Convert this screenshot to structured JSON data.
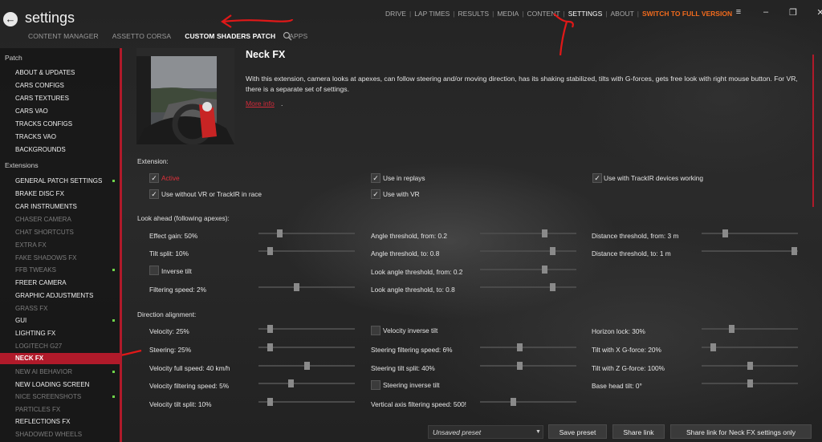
{
  "header": {
    "back_icon": "arrow-left-icon",
    "title": "settings",
    "subtabs": [
      {
        "label": "CONTENT MANAGER",
        "active": false
      },
      {
        "label": "ASSETTO CORSA",
        "active": false
      },
      {
        "label": "CUSTOM SHADERS PATCH",
        "active": true
      },
      {
        "label": "APPS",
        "active": false
      }
    ],
    "search_icon": "search-icon",
    "topnav": [
      "DRIVE",
      "LAP TIMES",
      "RESULTS",
      "MEDIA",
      "CONTENT",
      "SETTINGS",
      "ABOUT"
    ],
    "topnav_active": "SETTINGS",
    "full_version": "SWITCH TO FULL VERSION",
    "window_controls": [
      "menu-icon",
      "minimize-icon",
      "maximize-icon",
      "close-icon"
    ]
  },
  "sidebar": {
    "sections": [
      {
        "title": "Patch",
        "items": [
          {
            "label": "ABOUT & UPDATES"
          },
          {
            "label": "CARS CONFIGS"
          },
          {
            "label": "CARS TEXTURES"
          },
          {
            "label": "CARS VAO"
          },
          {
            "label": "TRACKS CONFIGS"
          },
          {
            "label": "TRACKS VAO"
          },
          {
            "label": "BACKGROUNDS"
          }
        ]
      },
      {
        "title": "Extensions",
        "items": [
          {
            "label": "GENERAL PATCH SETTINGS",
            "dot": true
          },
          {
            "label": "BRAKE DISC FX"
          },
          {
            "label": "CAR INSTRUMENTS"
          },
          {
            "label": "CHASER CAMERA",
            "dim": true
          },
          {
            "label": "CHAT SHORTCUTS",
            "dim": true
          },
          {
            "label": "EXTRA FX",
            "dim": true
          },
          {
            "label": "FAKE SHADOWS FX",
            "dim": true
          },
          {
            "label": "FFB TWEAKS",
            "dim": true,
            "dot": true
          },
          {
            "label": "FREER CAMERA"
          },
          {
            "label": "GRAPHIC ADJUSTMENTS"
          },
          {
            "label": "GRASS FX",
            "dim": true
          },
          {
            "label": "GUI",
            "dot": true
          },
          {
            "label": "LIGHTING FX"
          },
          {
            "label": "LOGITECH G27",
            "dim": true
          },
          {
            "label": "NECK FX",
            "selected": true
          },
          {
            "label": "NEW AI BEHAVIOR",
            "dim": true,
            "dot": true
          },
          {
            "label": "NEW LOADING SCREEN"
          },
          {
            "label": "NICE SCREENSHOTS",
            "dim": true,
            "dot": true
          },
          {
            "label": "PARTICLES FX",
            "dim": true
          },
          {
            "label": "REFLECTIONS FX"
          },
          {
            "label": "SHADOWED WHEELS",
            "dim": true
          }
        ]
      }
    ]
  },
  "main": {
    "title": "Neck FX",
    "description": "With this extension, camera looks at apexes, can follow steering and/or moving direction, has its shaking stabilized, tilts with G-forces, gets free look with right mouse button. For VR, there is a separate set of settings.",
    "more_info": "More info",
    "extension": {
      "title": "Extension:",
      "checks": [
        {
          "label": "Active",
          "checked": true,
          "red": true
        },
        {
          "label": "Use in replays",
          "checked": true
        },
        {
          "label": "Use with TrackIR devices working",
          "checked": true
        },
        {
          "label": "Use without VR or TrackIR in race",
          "checked": true
        },
        {
          "label": "Use with VR",
          "checked": true
        }
      ]
    },
    "look_ahead": {
      "title": "Look ahead (following apexes):",
      "effect_gain": {
        "label": "Effect gain: 50%",
        "value": 0.2
      },
      "tilt_split": {
        "label": "Tilt split: 10%",
        "value": 0.1
      },
      "inverse_tilt": {
        "label": "Inverse tilt",
        "checked": false
      },
      "filtering_speed": {
        "label": "Filtering speed: 2%",
        "value": 0.39
      },
      "angle_from": {
        "label": "Angle threshold, from: 0.2",
        "value": 0.68
      },
      "angle_to": {
        "label": "Angle threshold, to: 0.8",
        "value": 0.77
      },
      "look_angle_from": {
        "label": "Look angle threshold, from: 0.2",
        "value": 0.68
      },
      "look_angle_to": {
        "label": "Look angle threshold, to: 0.8",
        "value": 0.77
      },
      "distance_from": {
        "label": "Distance threshold, from: 3 m",
        "value": 0.23
      },
      "distance_to": {
        "label": "Distance threshold, to: 1 m",
        "value": 0.99
      }
    },
    "direction": {
      "title": "Direction alignment:",
      "velocity": {
        "label": "Velocity: 25%",
        "value": 0.1
      },
      "steering": {
        "label": "Steering: 25%",
        "value": 0.1
      },
      "velocity_full_speed": {
        "label": "Velocity full speed: 40 km/h",
        "value": 0.5
      },
      "velocity_filtering": {
        "label": "Velocity filtering speed: 5%",
        "value": 0.33
      },
      "velocity_tilt_split": {
        "label": "Velocity tilt split: 10%",
        "value": 0.1
      },
      "velocity_inverse_tilt": {
        "label": "Velocity inverse tilt",
        "checked": false
      },
      "steering_filtering": {
        "label": "Steering filtering speed: 6%",
        "value": 0.41
      },
      "steering_tilt_split": {
        "label": "Steering tilt split: 40%",
        "value": 0.41
      },
      "steering_inverse_tilt": {
        "label": "Steering inverse tilt",
        "checked": false
      },
      "vertical_axis": {
        "label": "Vertical axis filtering speed: 500!",
        "value": 0.34
      },
      "horizon_lock": {
        "label": "Horizon lock: 30%",
        "value": 0.3
      },
      "tilt_x": {
        "label": "Tilt with X G-force: 20%",
        "value": 0.1
      },
      "tilt_z": {
        "label": "Tilt with Z G-force: 100%",
        "value": 0.5
      },
      "base_head_tilt": {
        "label": "Base head tilt: 0°",
        "value": 0.5
      }
    }
  },
  "bottom": {
    "preset": "Unsaved preset",
    "save_preset": "Save preset",
    "share_link": "Share link",
    "share_link_neck": "Share link for Neck FX settings only"
  },
  "colors": {
    "accent": "#b01a2a",
    "orange": "#f26b1d",
    "active_text": "#e0303a"
  }
}
